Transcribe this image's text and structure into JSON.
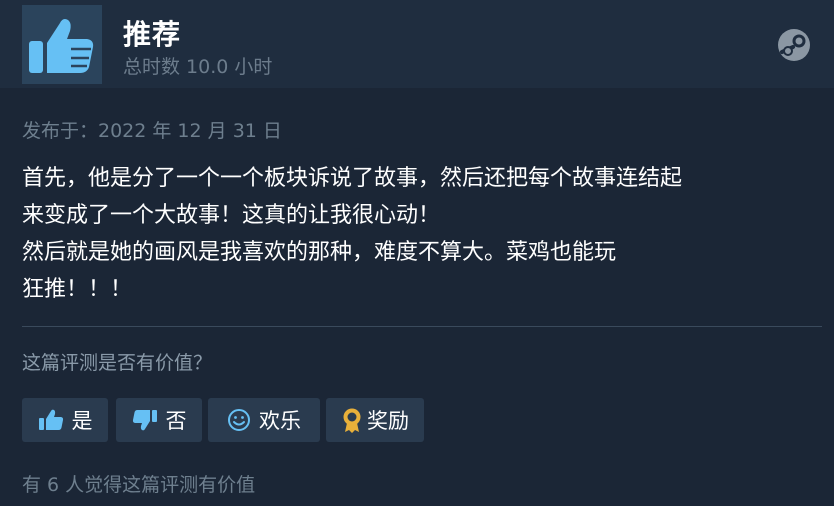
{
  "header": {
    "verdict": "推荐",
    "hours": "总时数 10.0 小时",
    "thumb_icon": "thumbs-up-icon",
    "logo_icon": "steam-logo-icon"
  },
  "posted": "发布于：2022 年 12 月 31 日",
  "review_lines": [
    "首先，他是分了一个一个板块诉说了故事，然后还把每个故事连结起",
    "来变成了一个大故事！这真的让我很心动！",
    "然后就是她的画风是我喜欢的那种，难度不算大。菜鸡也能玩",
    "狂推！！！"
  ],
  "helpful_question": "这篇评测是否有价值？",
  "buttons": {
    "yes": "是",
    "no": "否",
    "funny": "欢乐",
    "award": "奖励"
  },
  "helpful_count": "有 6 人觉得这篇评测有价值",
  "colors": {
    "background": "#1b2636",
    "header": "#1f2d3f",
    "thumb_box": "#2b445c",
    "thumb": "#66c0f4",
    "award_gold": "#e8b03a"
  }
}
